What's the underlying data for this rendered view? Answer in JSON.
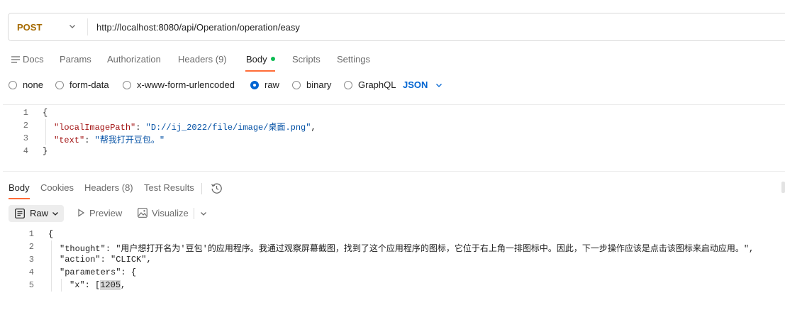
{
  "request": {
    "method": "POST",
    "url": "http://localhost:8080/api/Operation/operation/easy"
  },
  "tabs": {
    "docs": "Docs",
    "params": "Params",
    "authorization": "Authorization",
    "headers": "Headers (9)",
    "body": "Body",
    "scripts": "Scripts",
    "settings": "Settings"
  },
  "body_types": {
    "none": "none",
    "form_data": "form-data",
    "urlencoded": "x-www-form-urlencoded",
    "raw": "raw",
    "binary": "binary",
    "graphql": "GraphQL",
    "selected": "raw",
    "format": "JSON"
  },
  "request_body": {
    "line_numbers": [
      "1",
      "2",
      "3",
      "4"
    ],
    "open_brace": "{",
    "close_brace": "}",
    "key1": "\"localImagePath\"",
    "val1": "\"D://ij_2022/file/image/桌面.png\"",
    "key2": "\"text\"",
    "val2": "\"帮我打开豆包。\""
  },
  "response": {
    "tabs": {
      "body": "Body",
      "cookies": "Cookies",
      "headers": "Headers (8)",
      "test_results": "Test Results"
    },
    "view": {
      "raw": "Raw",
      "preview": "Preview",
      "visualize": "Visualize"
    },
    "line_numbers": [
      "1",
      "2",
      "3",
      "4",
      "5"
    ],
    "open_brace": "{",
    "thought_key": "\"thought\"",
    "thought_val": "\"用户想打开名为'豆包'的应用程序。我通过观察屏幕截图，找到了这个应用程序的图标，它位于右上角一排图标中。因此，下一步操作应该是点击该图标来启动应用。\"",
    "action_key": "\"action\"",
    "action_val": "\"CLICK\"",
    "parameters_key": "\"parameters\"",
    "x_key": "\"x\"",
    "x_open": "[",
    "x_value": "1205"
  },
  "colors": {
    "accent": "#ff6c37",
    "method": "#a56a00",
    "link_blue": "#0265d2",
    "status_green": "#0cbb52",
    "json_key": "#a31515",
    "json_string": "#0451a5"
  }
}
